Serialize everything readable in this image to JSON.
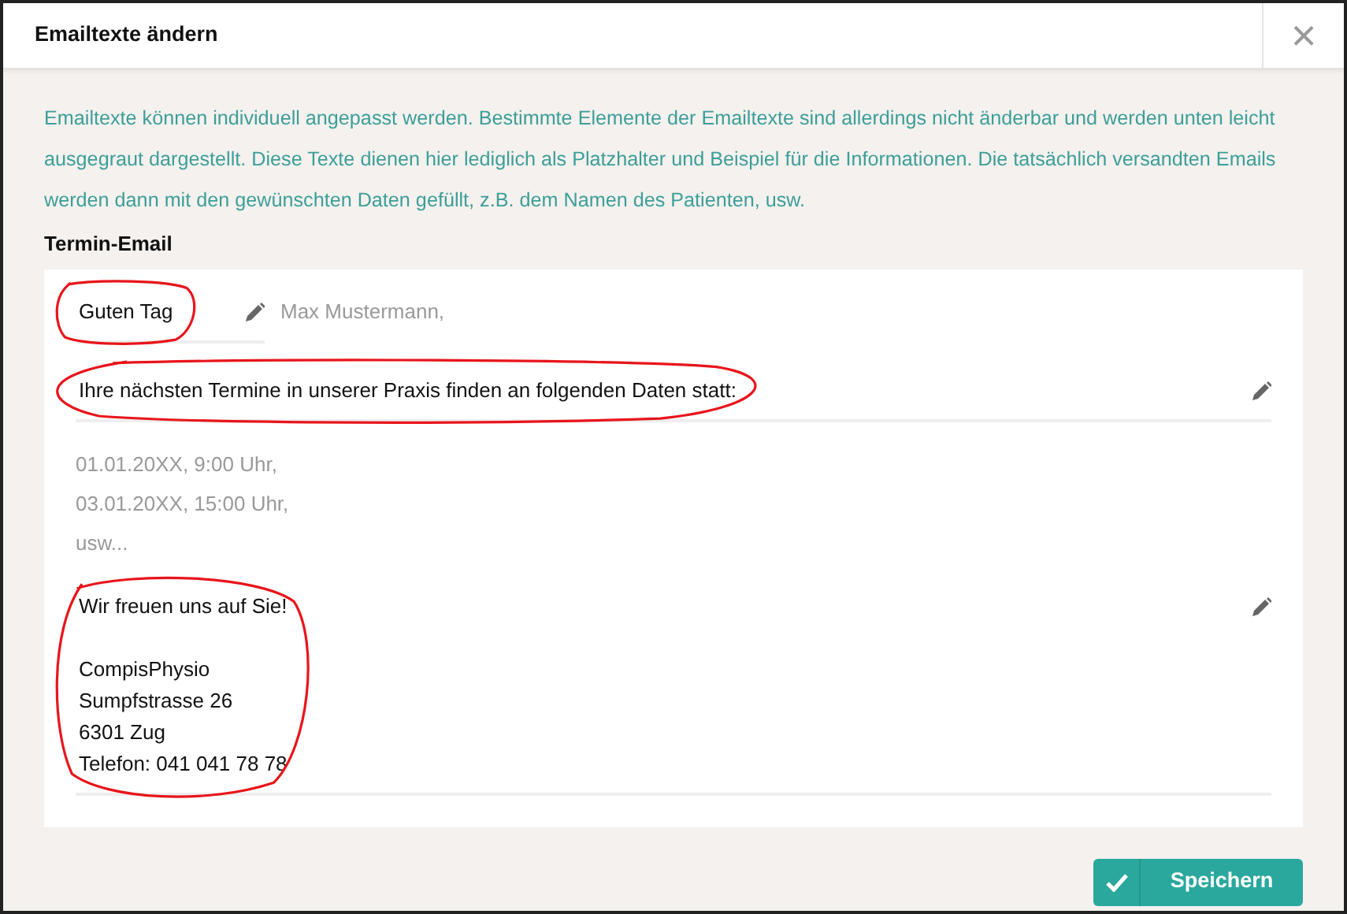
{
  "dialog": {
    "title": "Emailtexte ändern",
    "close": "×"
  },
  "intro": "Emailtexte können individuell angepasst werden. Bestimmte Elemente der Emailtexte sind allerdings nicht änderbar und werden unten leicht ausgegraut dargestellt. Diese Texte dienen hier lediglich als Platzhalter und Beispiel für die Informationen. Die tatsächlich versandten Emails werden dann mit den gewünschten Daten gefüllt, z.B. dem Namen des Patienten, usw.",
  "section_title": "Termin-Email",
  "blocks": [
    {
      "kind": "inline",
      "paragraphs": [
        [
          "Guten Tag"
        ]
      ],
      "highlighted": true,
      "fixed_text": "Max Mustermann,"
    },
    {
      "kind": "editable",
      "paragraphs": [
        [
          "Ihre nächsten Termine in unserer Praxis finden an folgenden Daten statt:"
        ]
      ],
      "highlighted": true
    },
    {
      "kind": "fixed",
      "paragraphs": [
        [
          "01.01.20XX, 9:00 Uhr,",
          "03.01.20XX, 15:00 Uhr,",
          "usw..."
        ]
      ]
    },
    {
      "kind": "editable",
      "paragraphs": [
        [
          "Wir freuen uns auf Sie!"
        ],
        [
          "CompisPhysio",
          "Sumpfstrasse 26",
          "6301 Zug",
          "Telefon: 041 041 78 78"
        ]
      ],
      "highlighted": true
    }
  ],
  "save_button": "Speichern"
}
